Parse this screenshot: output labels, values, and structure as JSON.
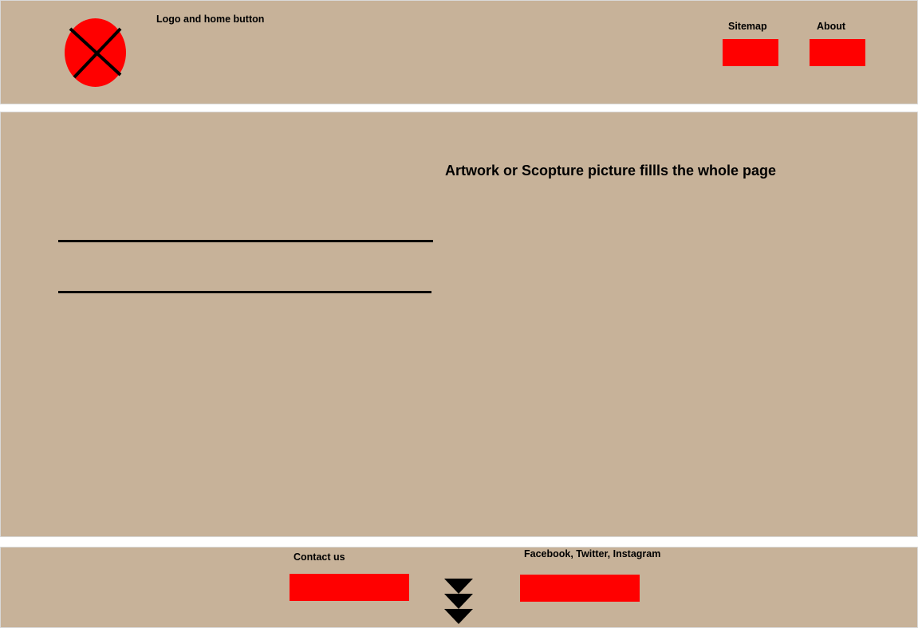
{
  "header": {
    "logo_caption": "Logo and home button",
    "nav": [
      {
        "label": "Sitemap"
      },
      {
        "label": "About"
      }
    ]
  },
  "main": {
    "caption": "Artwork or Scopture picture fillls the whole page"
  },
  "footer": {
    "contact_label": "Contact us",
    "social_label": "Facebook, Twitter, Instagram"
  },
  "colors": {
    "panel": "#c7b299",
    "button": "#ff0000",
    "logo": "#ff0000",
    "ink": "#000000"
  },
  "icons": {
    "logo": "x-circle-icon",
    "scroll": "triple-chevron-down-icon"
  }
}
